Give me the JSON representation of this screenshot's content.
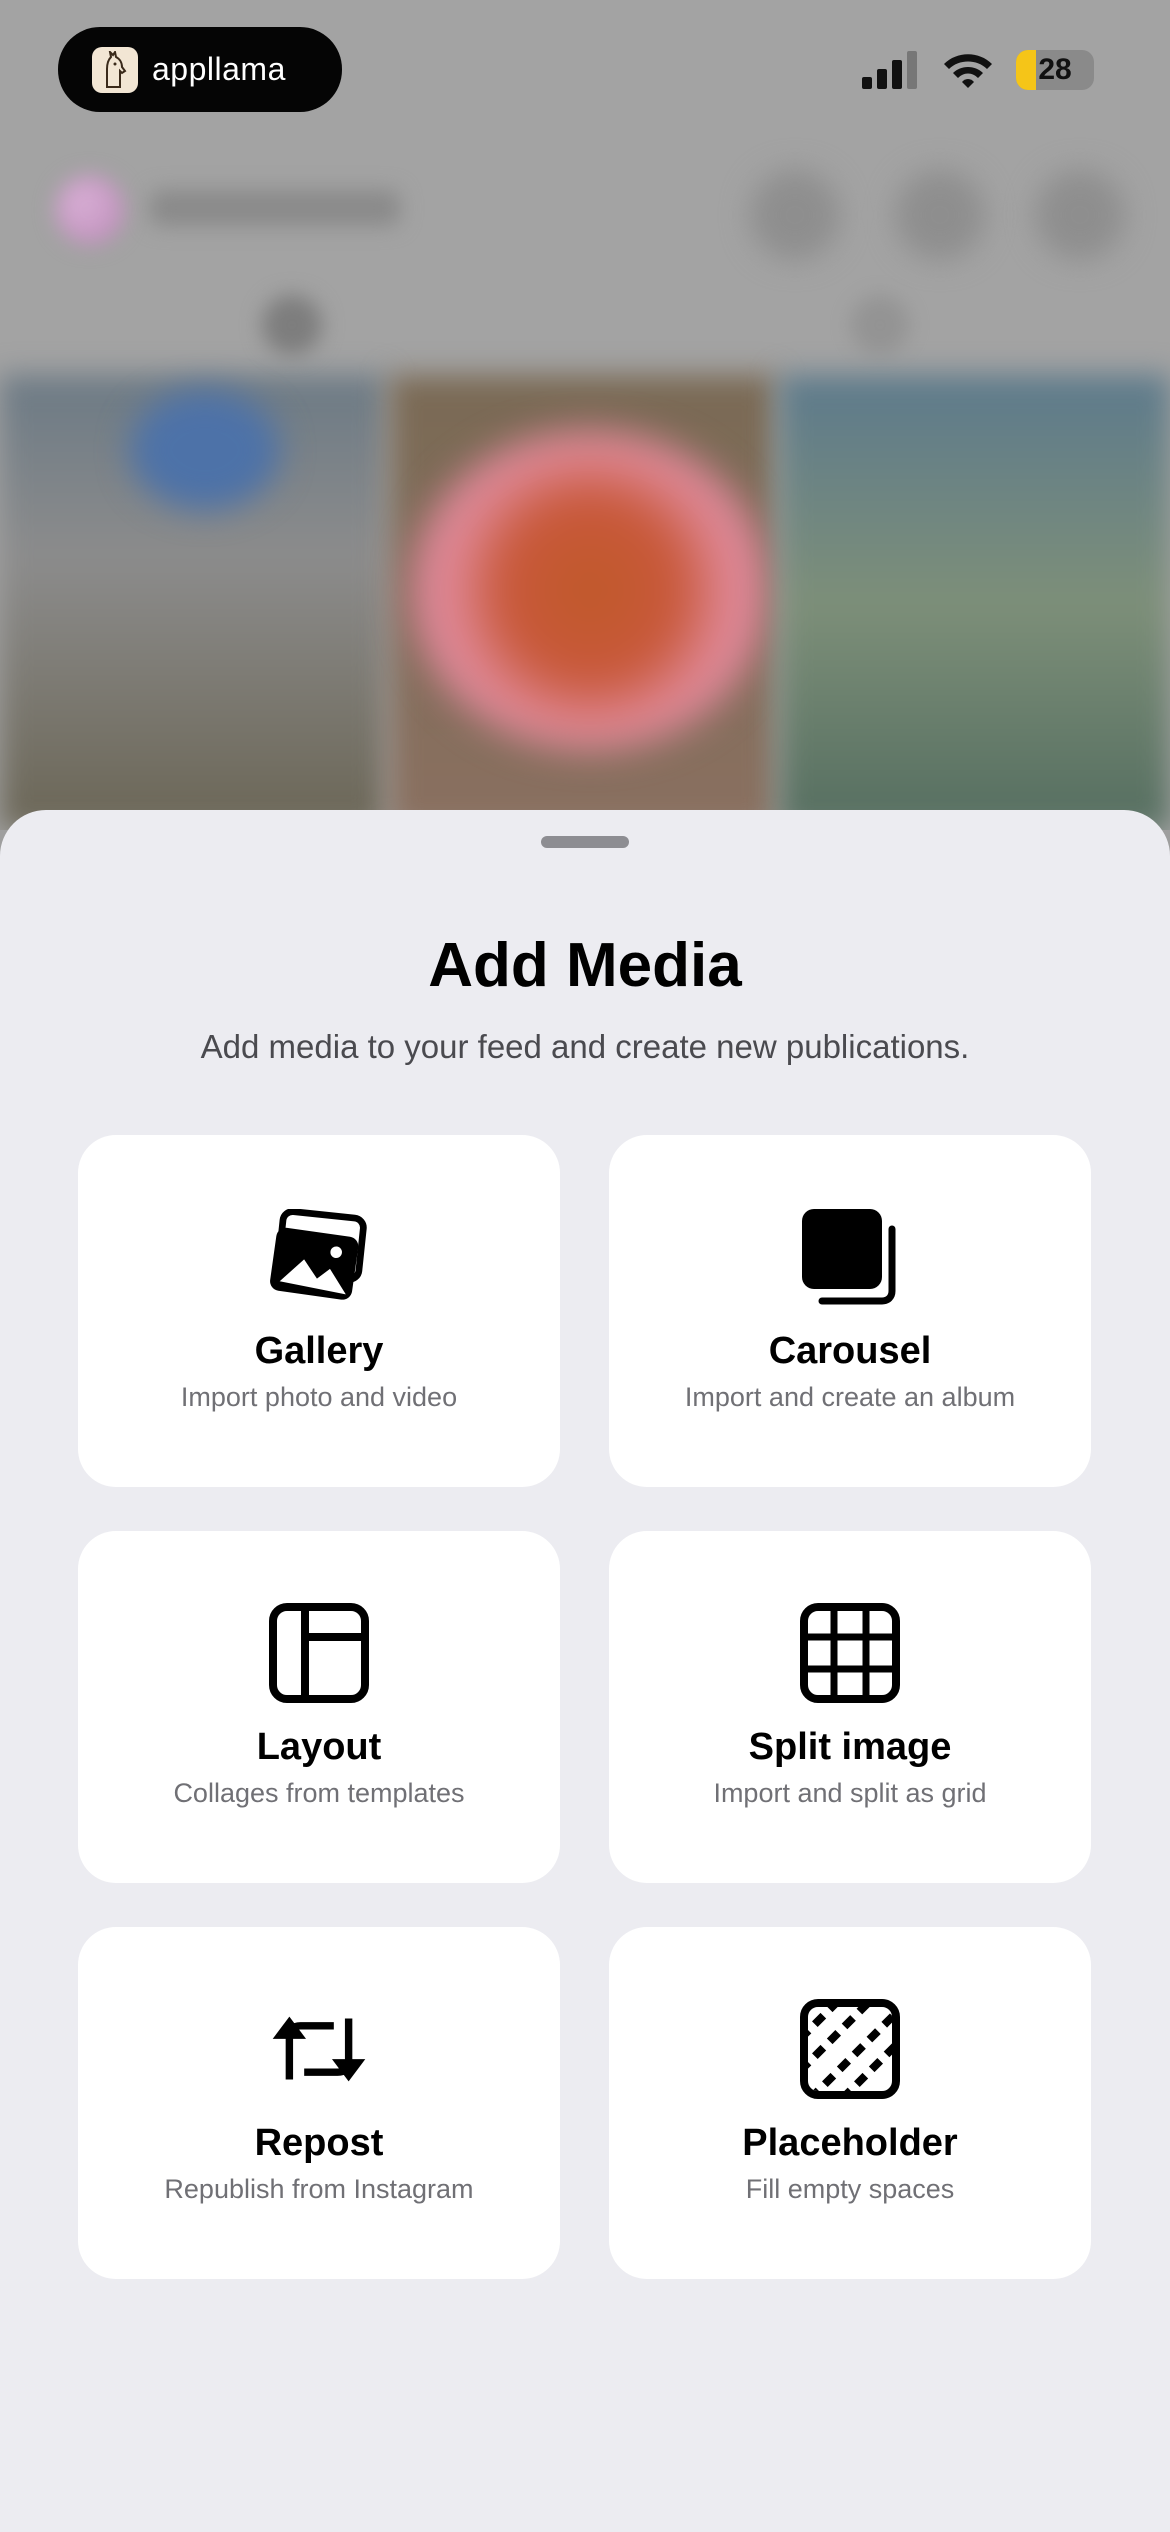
{
  "status_bar": {
    "brand_name": "appllama",
    "battery_level": "28",
    "battery_color": "#f5c518"
  },
  "sheet": {
    "title": "Add Media",
    "subtitle": "Add media to your feed and create new publications.",
    "options": [
      {
        "icon": "gallery-icon",
        "title": "Gallery",
        "subtitle": "Import photo and video"
      },
      {
        "icon": "carousel-icon",
        "title": "Carousel",
        "subtitle": "Import and create an album"
      },
      {
        "icon": "layout-icon",
        "title": "Layout",
        "subtitle": "Collages from templates"
      },
      {
        "icon": "split-image-icon",
        "title": "Split image",
        "subtitle": "Import and split as grid"
      },
      {
        "icon": "repost-icon",
        "title": "Repost",
        "subtitle": "Republish from Instagram"
      },
      {
        "icon": "placeholder-icon",
        "title": "Placeholder",
        "subtitle": "Fill empty spaces"
      }
    ]
  }
}
